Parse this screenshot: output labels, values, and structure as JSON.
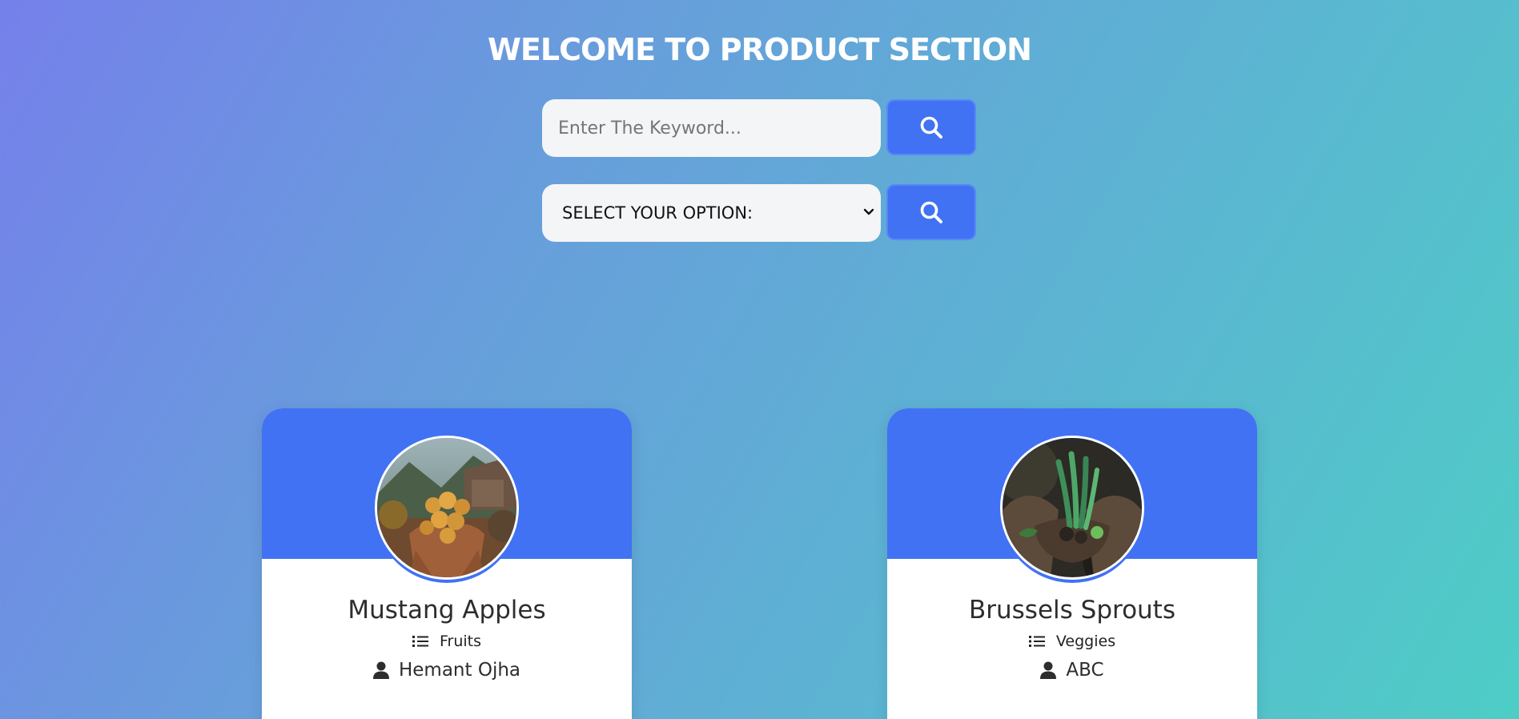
{
  "header": {
    "title": "WELCOME TO PRODUCT SECTION"
  },
  "search": {
    "placeholder": "Enter The Keyword...",
    "value": "",
    "button_icon": "search-icon"
  },
  "filter": {
    "selected": "SELECT YOUR OPTION:",
    "button_icon": "search-icon"
  },
  "colors": {
    "accent": "#4172f4",
    "input_bg": "#f4f5f7",
    "gradient_start": "#7580ea",
    "gradient_end": "#4ecdc6"
  },
  "products": [
    {
      "name": "Mustang Apples",
      "category": "Fruits",
      "owner": "Hemant Ojha",
      "image": "hands-holding-apples-photo",
      "category_icon": "list-icon",
      "owner_icon": "user-icon"
    },
    {
      "name": "Brussels Sprouts",
      "category": "Veggies",
      "owner": "ABC",
      "image": "hands-holding-vegetables-photo",
      "category_icon": "list-icon",
      "owner_icon": "user-icon"
    }
  ]
}
